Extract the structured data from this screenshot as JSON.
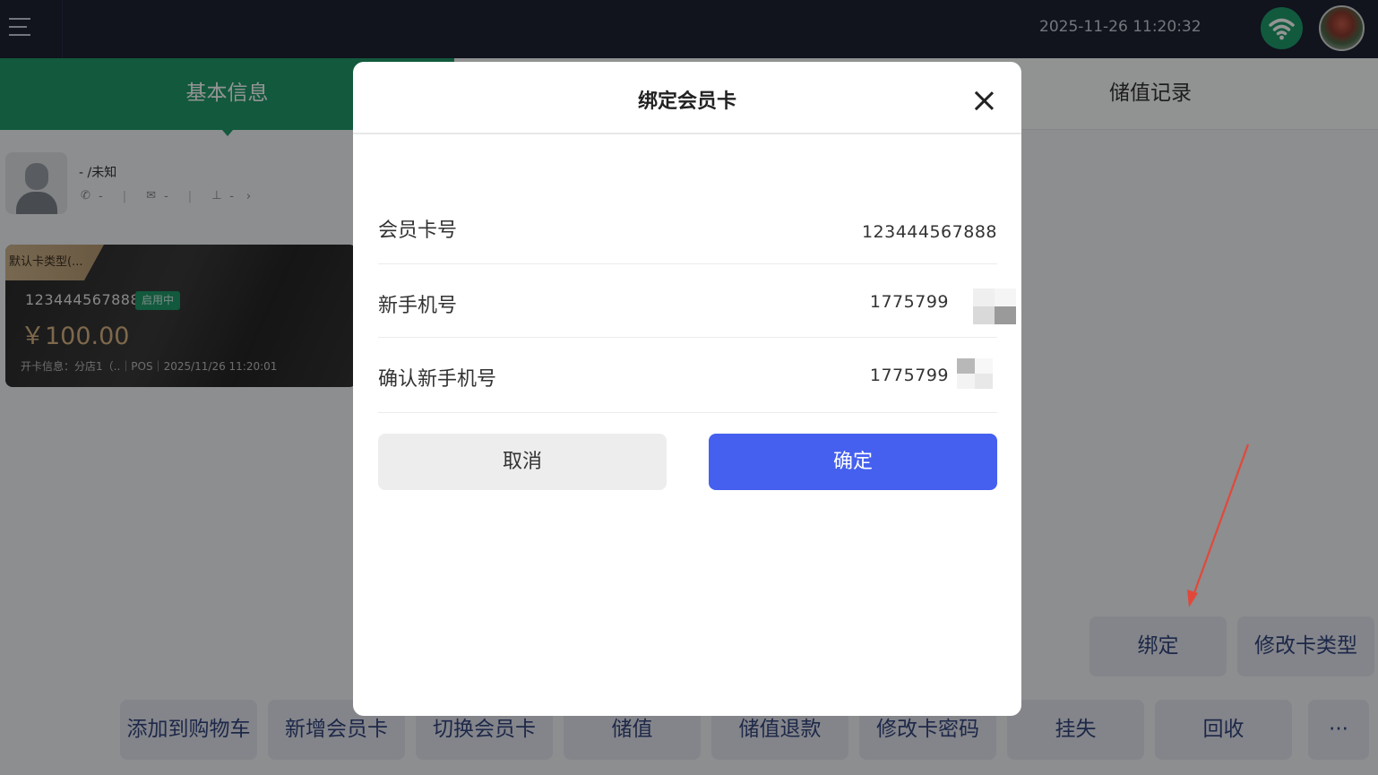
{
  "topbar": {
    "datetime": "2025-11-26 11:20:32"
  },
  "tabs": {
    "basic_info": "基本信息",
    "stored_value_records": "储值记录"
  },
  "member": {
    "name": "- /未知",
    "phone": "-",
    "email": "-",
    "store": "-"
  },
  "card": {
    "type_tag": "默认卡类型(...",
    "number": "123444567888",
    "status": "启用中",
    "balance": "￥100.00",
    "open_info": "开卡信息：分店1（..｜POS｜2025/11/26 11:20:01"
  },
  "actions": {
    "bind": "绑定",
    "modify_card_type": "修改卡类型",
    "add_to_cart": "添加到购物车",
    "new_card": "新增会员卡",
    "switch_card": "切换会员卡",
    "recharge": "储值",
    "recharge_refund": "储值退款",
    "change_password": "修改卡密码",
    "report_loss": "挂失",
    "recycle": "回收",
    "more": "···"
  },
  "modal": {
    "title": "绑定会员卡",
    "fields": [
      {
        "label": "会员卡号",
        "value": "123444567888"
      },
      {
        "label": "新手机号",
        "value": "1775799"
      },
      {
        "label": "确认新手机号",
        "value": "1775799"
      }
    ],
    "cancel": "取消",
    "confirm": "确定"
  },
  "colors": {
    "accent_green": "#1f9a6a",
    "primary_blue": "#4560ee",
    "topbar_bg": "#1e2233",
    "annotation_arrow": "#e2483a"
  }
}
